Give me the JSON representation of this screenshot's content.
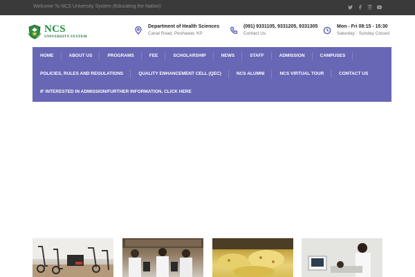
{
  "topbar": {
    "welcome": "Welcome To NCS University System (Educating the Nation)",
    "socials": [
      "twitter-icon",
      "facebook-icon",
      "instagram-icon",
      "youtube-icon"
    ]
  },
  "logo": {
    "brand": "NCS",
    "subtitle": "UNIVERSITY SYSTEM"
  },
  "contact": {
    "location": {
      "title": "Department of Health Sciences",
      "subtitle": "Canal Road, Peshawar, KP",
      "icon": "map-pin-icon"
    },
    "phone": {
      "title": "(091) 9331105, 9331205, 9331305",
      "subtitle": "Contact Us",
      "icon": "phone-icon"
    },
    "hours": {
      "title": "Mon - Fri 08:15 - 15:30",
      "subtitle": "Saturday - Sunday Closed",
      "icon": "clock-icon"
    }
  },
  "nav": {
    "color": "#6867b5",
    "row1": [
      "HOME",
      "ABOUT US",
      "PROGRAMS",
      "FEE",
      "SCHOLARSHIP",
      "NEWS",
      "STAFF",
      "ADMISSION",
      "CAMPUSES"
    ],
    "row2": [
      "POLICIES, RULES AND REGULATIONS",
      "QUALITY ENHANCEMENT CELL (QEC)",
      "NCS ALUMNI",
      "NCS VIRTUAL TOUR",
      "CONTACT US"
    ],
    "row3": [
      "IF INTERESTED IN ADMISSION/FURTHER INFORMATION, CLICK HERE"
    ]
  },
  "gallery": [
    "gym-photo",
    "lab-photo",
    "food-photo",
    "clinic-photo"
  ],
  "colors": {
    "topbar": "#3a3a3a",
    "accent": "#6867b5",
    "brand_green": "#1f8a3a"
  }
}
